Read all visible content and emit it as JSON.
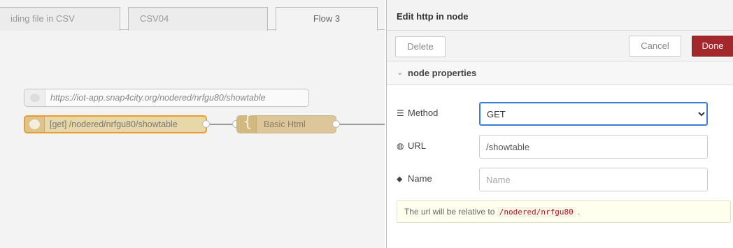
{
  "tabs": [
    {
      "label": "iding file in CSV"
    },
    {
      "label": "CSV04"
    },
    {
      "label": "Flow 3",
      "active": true
    }
  ],
  "canvas": {
    "comment_node": {
      "label": "https://iot-app.snap4city.org/nodered/nrfgu80/showtable"
    },
    "http_in_node": {
      "label": "[get] /nodered/nrfgu80/showtable",
      "icon": "globe-icon"
    },
    "template_node": {
      "label": "Basic Html",
      "icon": "brace-icon"
    }
  },
  "tray": {
    "title": "Edit http in node",
    "delete_label": "Delete",
    "cancel_label": "Cancel",
    "done_label": "Done",
    "section_label": "node properties",
    "method": {
      "label": "Method",
      "icon": "list-icon",
      "value": "GET",
      "options": [
        "GET"
      ]
    },
    "url": {
      "label": "URL",
      "icon": "globe-icon",
      "value": "/showtable"
    },
    "name": {
      "label": "Name",
      "icon": "tag-icon",
      "placeholder": "Name",
      "value": ""
    },
    "tip": {
      "prefix": "The url will be relative to",
      "code": "/nodered/nrfgu80",
      "suffix": "."
    }
  },
  "colors": {
    "done_button": "#a3282c",
    "http_node_border": "#e79d30",
    "http_node_fill": "#e8d8a8",
    "template_node_fill": "#dcc69a"
  }
}
